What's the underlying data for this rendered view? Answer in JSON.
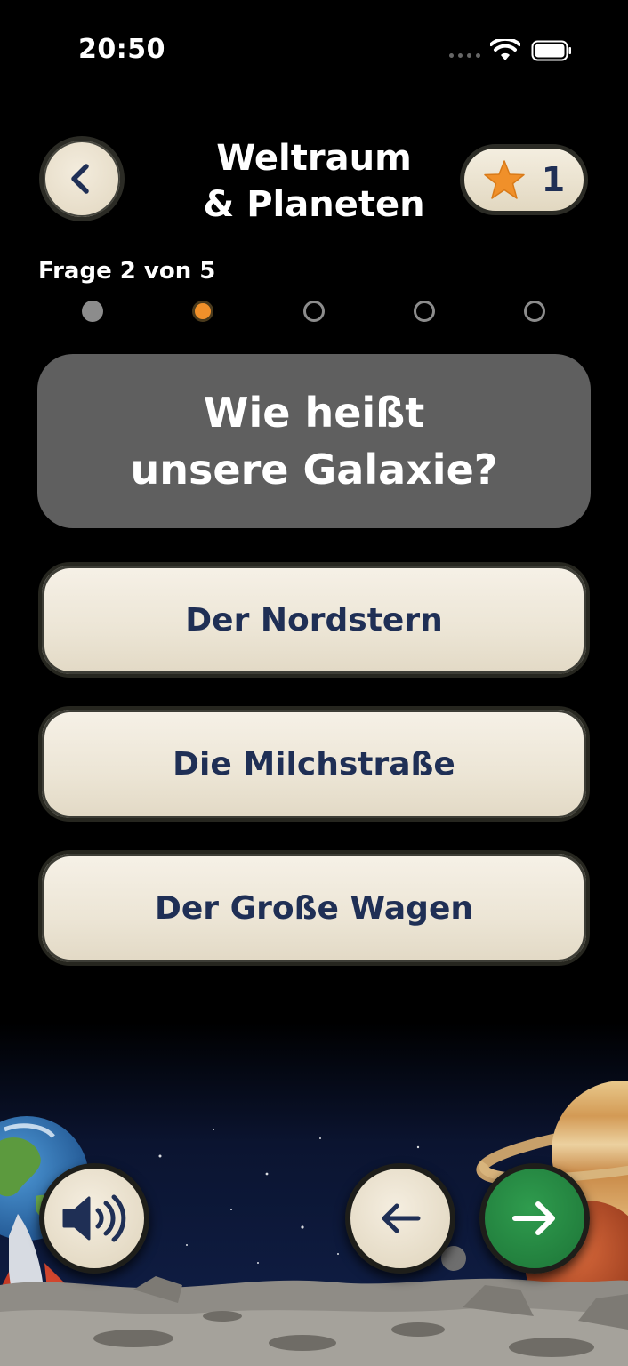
{
  "status_bar": {
    "time": "20:50"
  },
  "header": {
    "title_line1": "Weltraum",
    "title_line2": "& Planeten",
    "star_count": "1",
    "back_icon": "chevron-left-icon",
    "star_icon": "star-icon"
  },
  "progress": {
    "label": "Frage 2 von 5",
    "current": 2,
    "total": 5
  },
  "question": {
    "line1": "Wie heißt",
    "line2": "unsere Galaxie?"
  },
  "answers": [
    {
      "label": "Der Nordstern"
    },
    {
      "label": "Die Milchstraße"
    },
    {
      "label": "Der Große Wagen"
    }
  ],
  "controls": {
    "speaker_icon": "speaker-icon",
    "prev_icon": "arrow-left-icon",
    "next_icon": "arrow-right-icon"
  },
  "colors": {
    "accent_orange": "#f0902a",
    "button_cream": "#efe8d8",
    "text_navy": "#1f2f55",
    "next_green": "#1f7a3a",
    "question_bg": "#5f5f5f"
  }
}
